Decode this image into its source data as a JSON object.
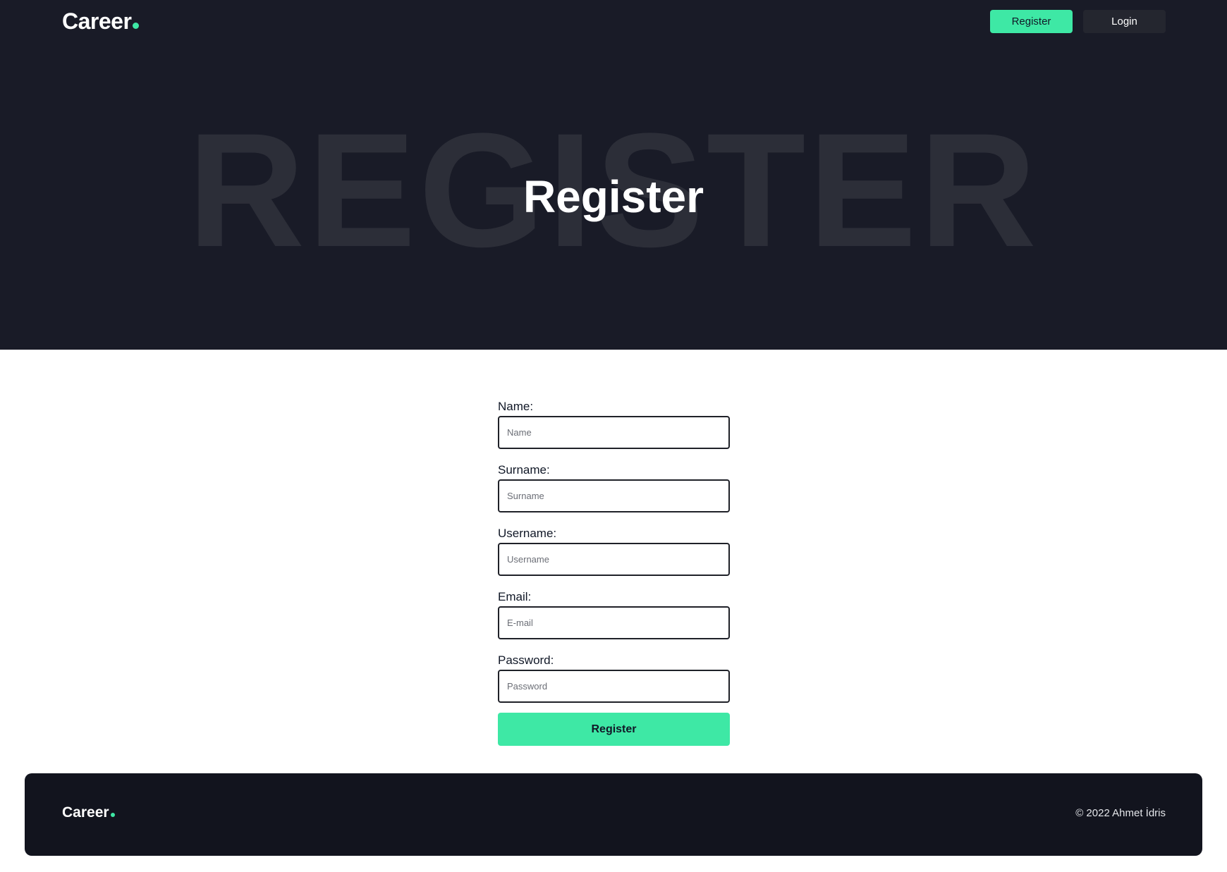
{
  "header": {
    "logo_text": "Career",
    "register_label": "Register",
    "login_label": "Login"
  },
  "hero": {
    "background_text": "REGISTER",
    "title": "Register"
  },
  "form": {
    "fields": [
      {
        "label": "Name:",
        "placeholder": "Name",
        "value": ""
      },
      {
        "label": "Surname:",
        "placeholder": "Surname",
        "value": ""
      },
      {
        "label": "Username:",
        "placeholder": "Username",
        "value": ""
      },
      {
        "label": "Email:",
        "placeholder": "E-mail",
        "value": ""
      },
      {
        "label": "Password:",
        "placeholder": "Password",
        "value": ""
      }
    ],
    "submit_label": "Register"
  },
  "footer": {
    "logo_text": "Career",
    "copyright": "© 2022 Ahmet İdris"
  },
  "colors": {
    "accent": "#3ee8a5",
    "hero_bg": "#191b27",
    "footer_bg": "#12141e"
  }
}
